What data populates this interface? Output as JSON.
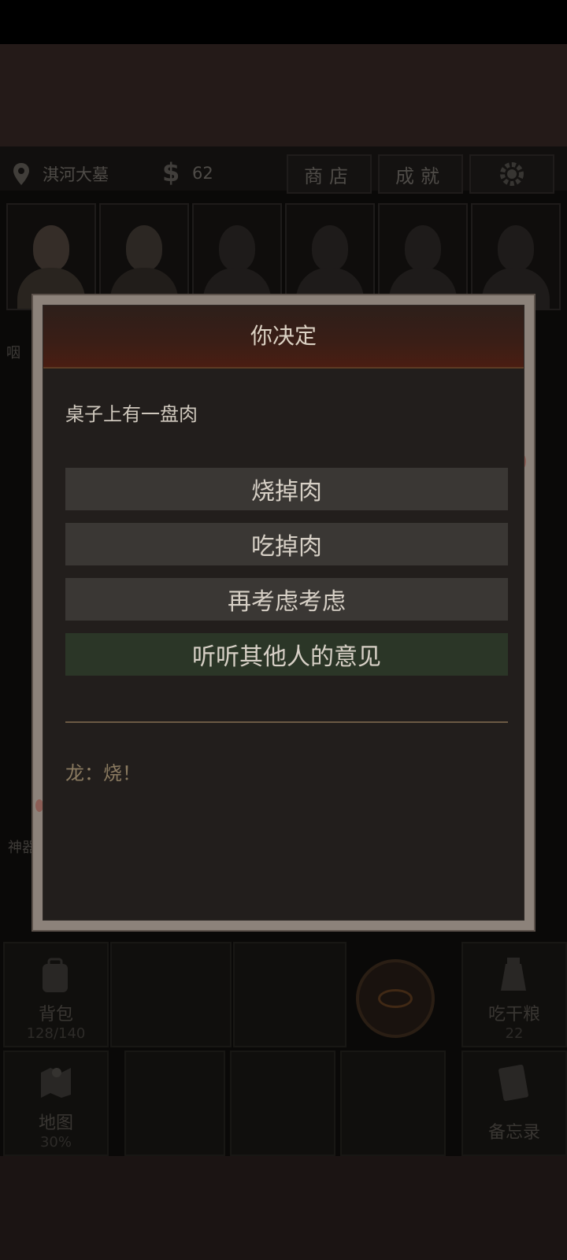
{
  "hud": {
    "location": "淇河大墓",
    "money": "62",
    "money_icon": "$",
    "shop_label": "商店",
    "achievements_label": "成就"
  },
  "side": {
    "left_top": "咽",
    "left_mid": "神器"
  },
  "bottom_menu": {
    "backpack": {
      "label": "背包",
      "value": "128/140"
    },
    "eat": {
      "label": "吃干粮",
      "value": "22"
    },
    "map": {
      "label": "地图",
      "value": "30%"
    },
    "memo": {
      "label": "备忘录"
    }
  },
  "dialog": {
    "title": "你决定",
    "prompt": "桌子上有一盘肉",
    "choices": [
      {
        "label": "烧掉肉"
      },
      {
        "label": "吃掉肉"
      },
      {
        "label": "再考虑考虑"
      },
      {
        "label": "听听其他人的意见"
      }
    ],
    "reply": "龙：烧！"
  },
  "colors": {
    "dialog_header": "#4a1d12",
    "choice_default": "#3a3734",
    "choice_highlight": "#2b3627",
    "frame": "#8c827a"
  },
  "icons": [
    "location-pin-icon",
    "gear-icon",
    "backpack-icon",
    "food-bag-icon",
    "map-icon",
    "memo-icon",
    "eye-icon"
  ]
}
